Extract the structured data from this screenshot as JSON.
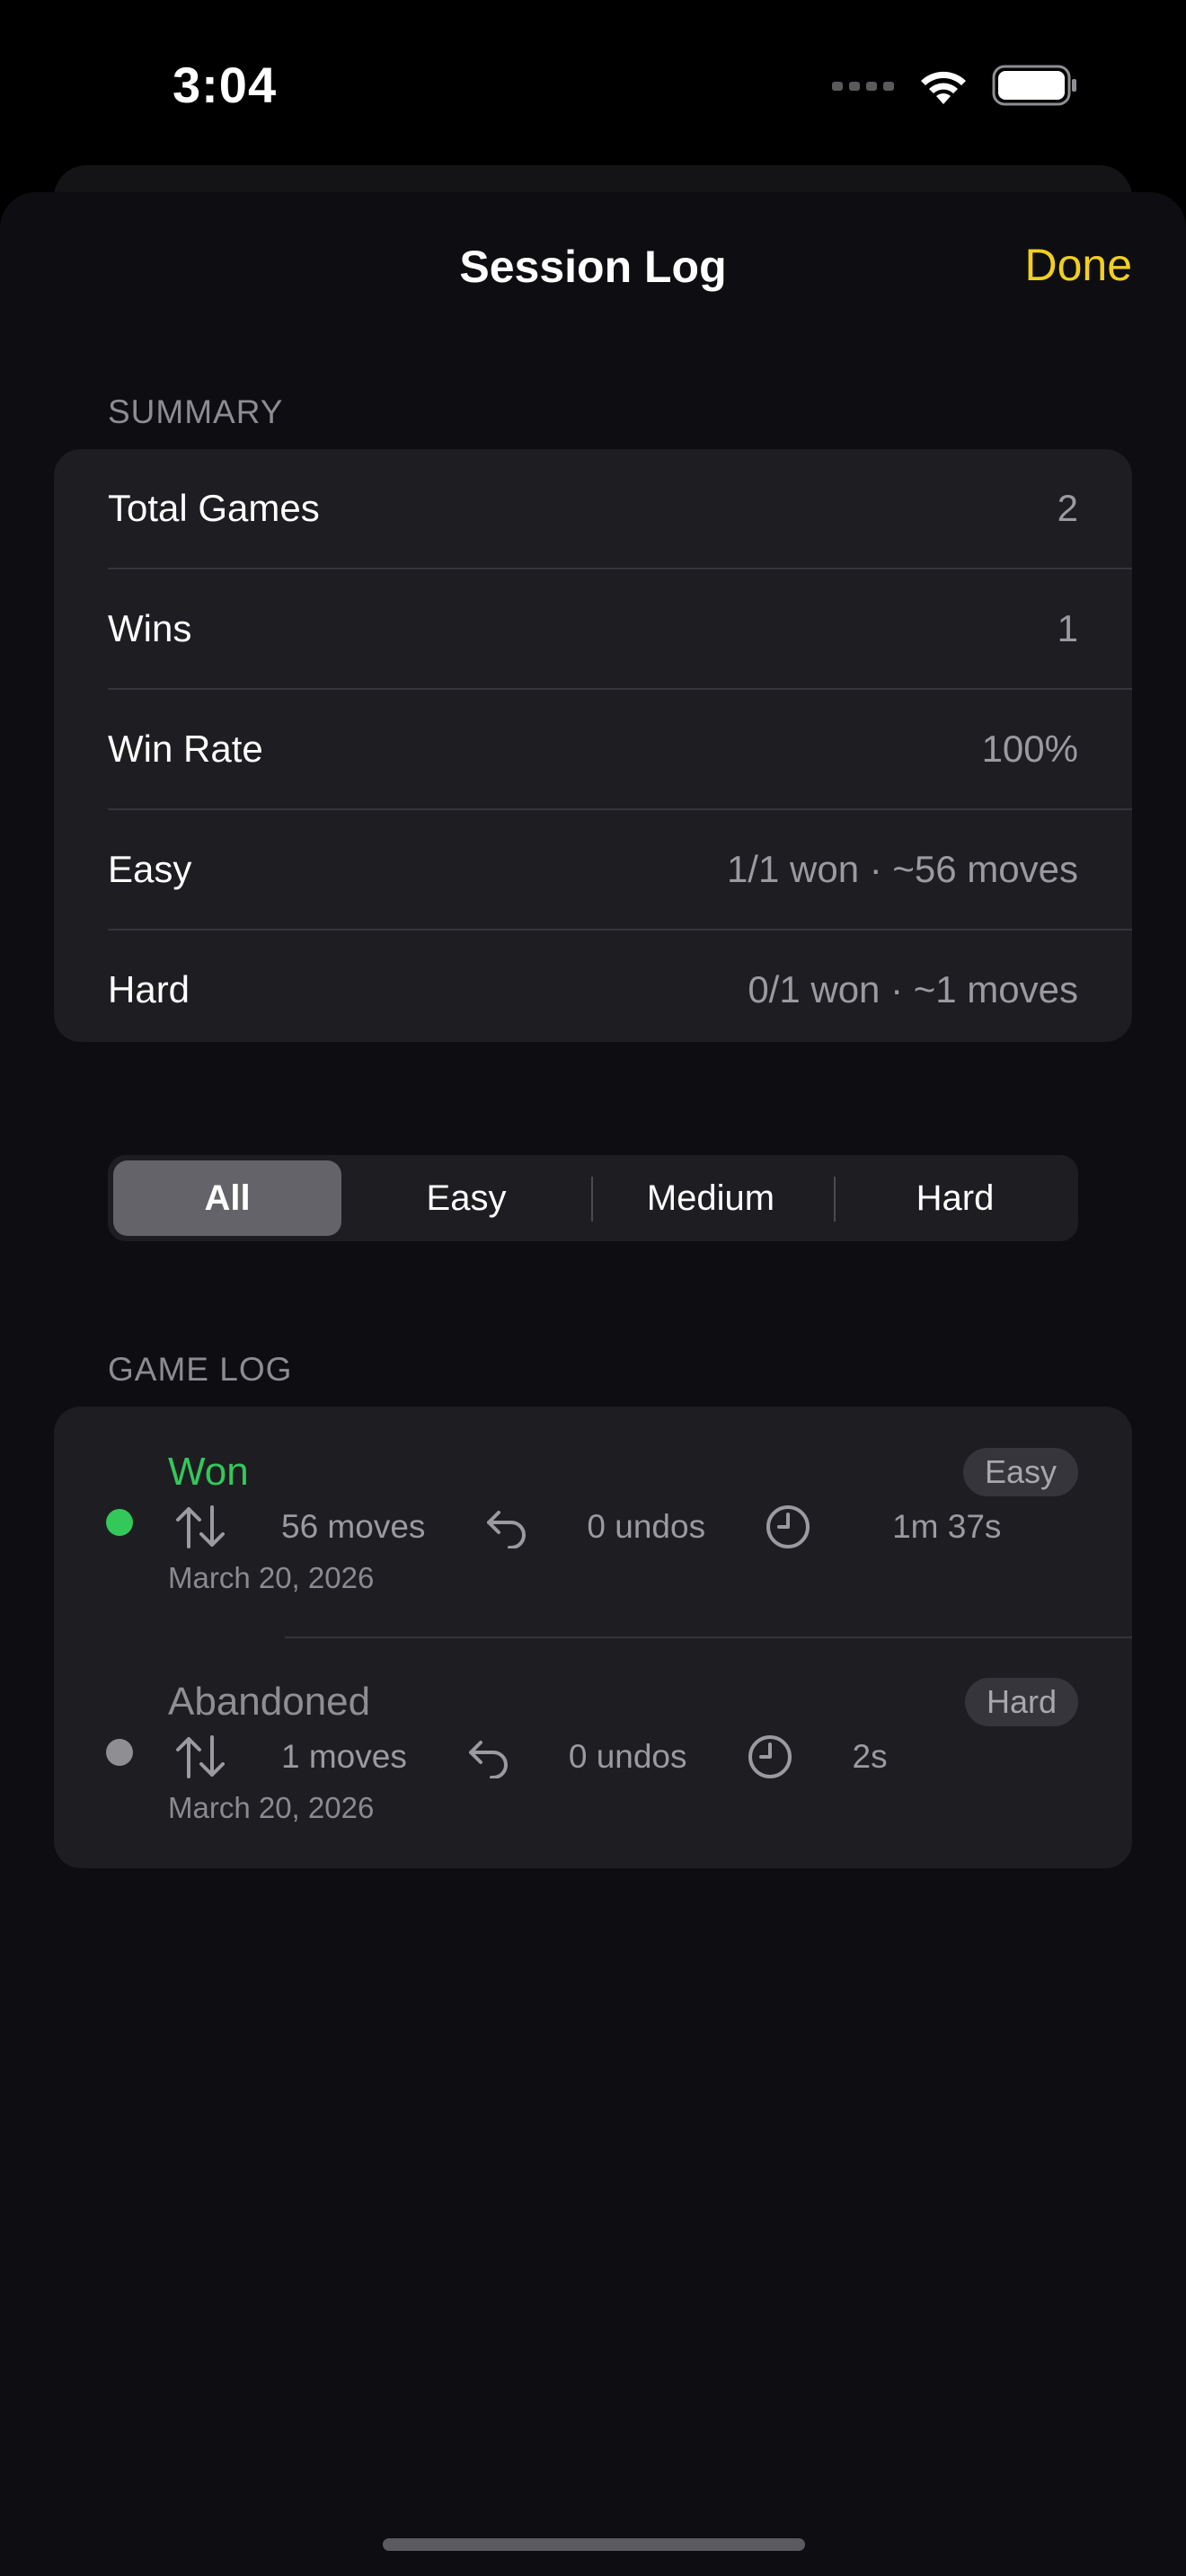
{
  "status_bar": {
    "time": "3:04"
  },
  "nav": {
    "title": "Session Log",
    "done_label": "Done"
  },
  "summary": {
    "header": "SUMMARY",
    "rows": [
      {
        "label": "Total Games",
        "value": "2"
      },
      {
        "label": "Wins",
        "value": "1"
      },
      {
        "label": "Win Rate",
        "value": "100%"
      },
      {
        "label": "Easy",
        "value": "1/1 won · ~56 moves"
      },
      {
        "label": "Hard",
        "value": "0/1 won · ~1 moves"
      }
    ]
  },
  "filter": {
    "options": [
      "All",
      "Easy",
      "Medium",
      "Hard"
    ],
    "selected": "All"
  },
  "game_log": {
    "header": "GAME LOG",
    "entries": [
      {
        "result": "Won",
        "difficulty": "Easy",
        "moves": "56 moves",
        "undos": "0 undos",
        "duration": "1m 37s",
        "date": "March 20, 2026",
        "result_color": "#34c759"
      },
      {
        "result": "Abandoned",
        "difficulty": "Hard",
        "moves": "1 moves",
        "undos": "0 undos",
        "duration": "2s",
        "date": "March 20, 2026",
        "result_color": "#8e8e93"
      }
    ]
  },
  "colors": {
    "accent": "#f2cf1f",
    "won": "#34c759",
    "abandoned": "#8e8e93"
  }
}
